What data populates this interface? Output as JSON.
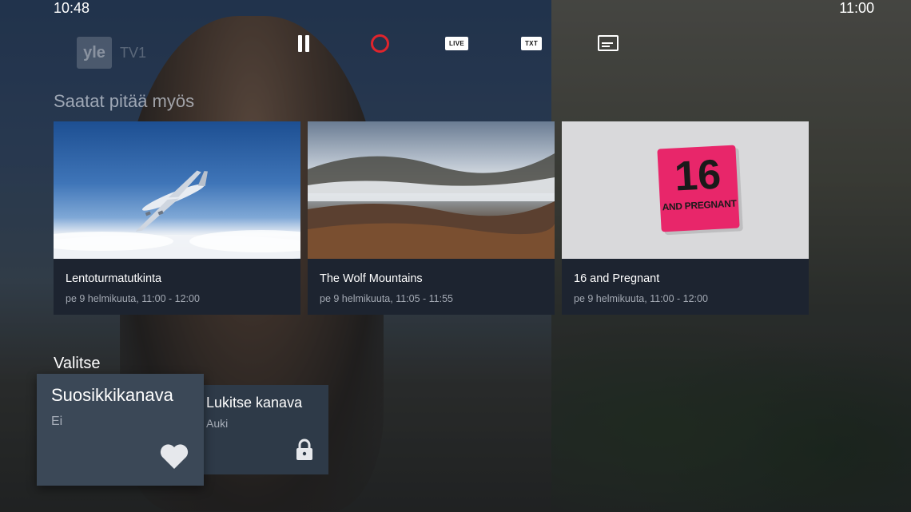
{
  "status_bar": {
    "time_left": "10:48",
    "time_right": "11:00"
  },
  "channel_logo": {
    "text": "yle",
    "suffix": "TV1"
  },
  "controls": {
    "pause_icon": "pause-icon",
    "record_icon": "record-icon",
    "live_label": "LIVE",
    "txt_label": "TXT",
    "subtitle_icon": "subtitles-icon"
  },
  "recommendations": {
    "title": "Saatat pitää myös",
    "items": [
      {
        "title": "Lentoturmatutkinta",
        "time": "pe 9 helmikuuta, 11:00 - 12:00",
        "image": "airplane-in-sky"
      },
      {
        "title": "The Wolf Mountains",
        "time": "pe 9 helmikuuta, 11:05 - 11:55",
        "image": "misty-mountains"
      },
      {
        "title": "16 and Pregnant",
        "time": "pe 9 helmikuuta, 11:00 - 12:00",
        "image": "16-and-pregnant-logo",
        "logo_big": "16",
        "logo_small": "AND PREGNANT"
      }
    ]
  },
  "options": {
    "title": "Valitse",
    "favorite": {
      "label": "Suosikkikanava",
      "value": "Ei",
      "icon": "heart-icon"
    },
    "lock": {
      "label": "Lukitse kanava",
      "value": "Auki",
      "icon": "lock-icon"
    }
  },
  "colors": {
    "record": "#e0242c",
    "card_bg": "#1d2430",
    "selected_option_bg": "#3b4857"
  }
}
